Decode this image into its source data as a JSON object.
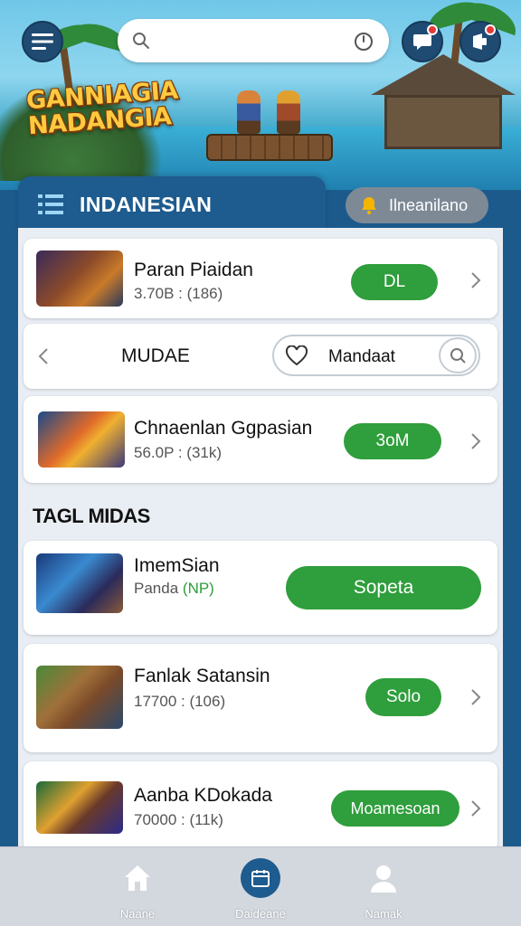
{
  "banner": {
    "logo_line1": "GANNIAGIA",
    "logo_line2": "NADANGIA"
  },
  "topbar": {
    "search_placeholder": "",
    "search_icon": "search-icon",
    "scan_icon": "clock-icon",
    "chat_icon": "chat-bubble-icon",
    "alert_icon": "megaphone-icon"
  },
  "section": {
    "title": "INDANESIAN",
    "language_button": "Ilneanilano"
  },
  "filter": {
    "label": "MUDAE",
    "pill_text": "Mandaat"
  },
  "list_label": "TAGL MIDAS",
  "apps": [
    {
      "name": "Paran Piaidan",
      "meta": "3.70B : (186)",
      "button": "DL"
    },
    {
      "name": "Chnaenlan Ggpasian",
      "meta": "56.0P : (31k)",
      "button": "3oM"
    },
    {
      "name": "ImemSian",
      "meta_prefix": "Panda",
      "meta_highlight": "(NP)",
      "button": "Sopeta"
    },
    {
      "name": "Fanlak Satansin",
      "meta": "17700 : (106)",
      "button": "Solo"
    },
    {
      "name": "Aanba KDokada",
      "meta": "70000 : (11k)",
      "button": "Moamesoan"
    }
  ],
  "nav": [
    {
      "label": "Naane",
      "icon": "home-icon"
    },
    {
      "label": "Daideane",
      "icon": "calendar-icon"
    },
    {
      "label": "Namak",
      "icon": "user-icon"
    }
  ],
  "colors": {
    "primary_blue": "#1e5b8e",
    "accent_green": "#2f9e3c",
    "panel_bg": "#e9eef4"
  }
}
